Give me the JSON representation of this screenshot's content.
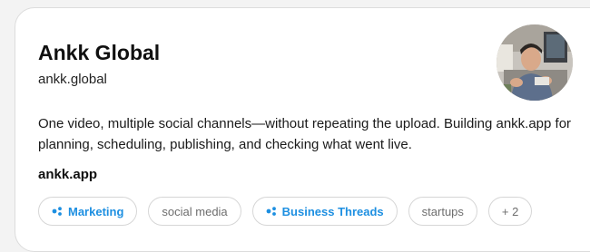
{
  "profile": {
    "name": "Ankk Global",
    "handle": "ankk.global",
    "bio": "One video, multiple social channels—without repeating the upload. Building ankk.app for planning, scheduling, publishing, and checking what went live.",
    "link": "ankk.app"
  },
  "tags": [
    {
      "label": "Marketing",
      "icon": "topic-icon",
      "style": "topic"
    },
    {
      "label": "social media",
      "style": "plain"
    },
    {
      "label": "Business Threads",
      "icon": "topic-icon",
      "style": "topic"
    },
    {
      "label": "startups",
      "style": "plain"
    },
    {
      "label": "+ 2",
      "style": "plain"
    }
  ],
  "colors": {
    "topic_accent": "#1d8fe1",
    "tag_border": "#d6d6d6",
    "card_border": "#dcdcdc"
  }
}
